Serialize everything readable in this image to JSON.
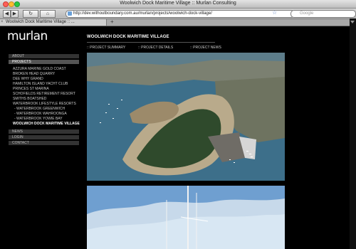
{
  "window": {
    "title": "Woolwich Dock Maritime Village :: Murlan Consulting"
  },
  "toolbar": {
    "back_label": "◀",
    "forward_label": "▶",
    "reload_label": "↻",
    "home_label": "⌂",
    "url": "http://dev.withoutboundary.com.au/murlan/projects/woolwich-dock-village/",
    "search_placeholder": "Google"
  },
  "tab": {
    "title": "Woolwich Dock Maritime Village :: ...",
    "close_label": "×",
    "add_label": "+"
  },
  "site": {
    "logo": "murlan",
    "menu": {
      "about": "ABOUT",
      "projects": "PROJECTS",
      "news": "NEWS",
      "login": "LOGIN",
      "contact": "CONTACT"
    },
    "projects": [
      "AZZURA MARINE GOLD COAST",
      "BROKEN HEAD QUARRY",
      "DEE WHY GRAND",
      "HAMILTON ISLAND YACHT CLUB",
      "PRINCES ST MARINA",
      "SCHOFIELDS RETIREMENT RESORT",
      "SMITHS BOATSHED",
      "WATERBROOK LIFESTYLE RESORTS",
      "- WATERBROOK GREENWICH",
      "- WATERBROOK WAHROONGA",
      "- WATERBROOK YOWIE BAY",
      "WOOLWICH DOCK MARITIME VILLAGE"
    ],
    "project_title": "WOOLWICH DOCK MARITIME VILLAGE",
    "subnav": {
      "summary": ":: PROJECT SUMMARY",
      "details": ":: PROJECT DETAILS",
      "news": ":: PROJECT NEWS"
    }
  },
  "colors": {
    "page_bg": "#000000",
    "menu_bg": "#333333",
    "menu_active_bg": "#555555",
    "water": "#3d6f8a",
    "sky": "#6f9fd0"
  }
}
